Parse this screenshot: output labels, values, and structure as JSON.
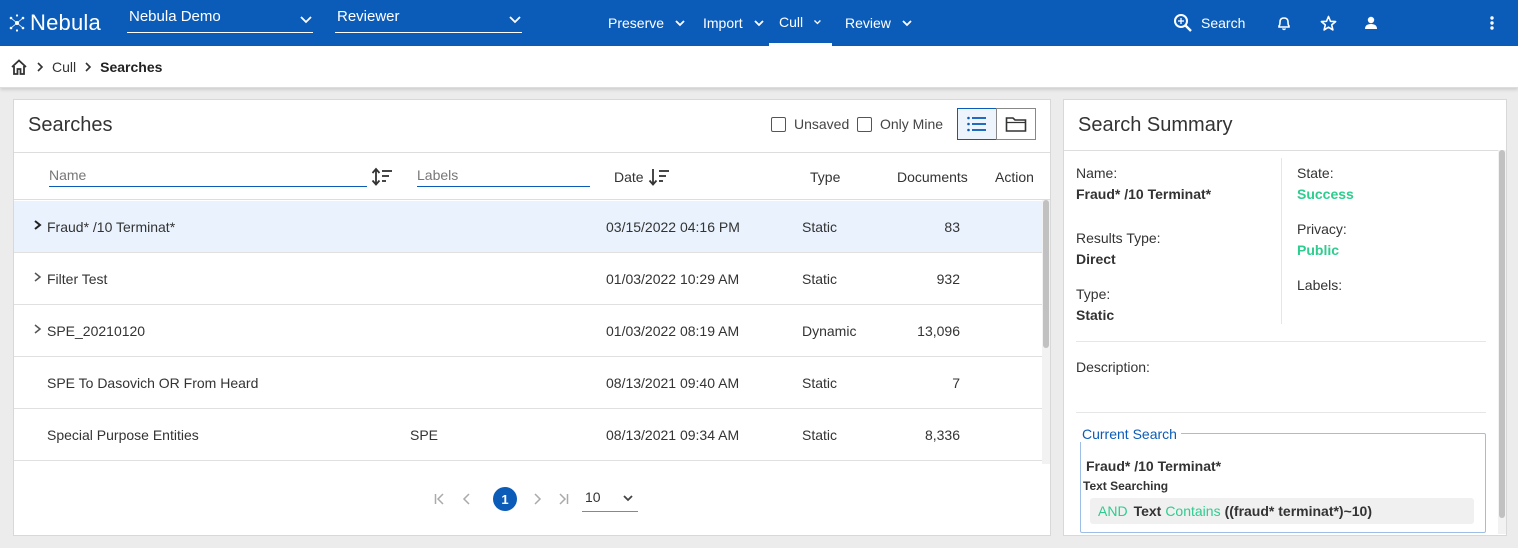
{
  "topbar": {
    "logo_text": "Nebula",
    "project_select": "Nebula Demo",
    "role_select": "Reviewer",
    "nav": [
      {
        "label": "Preserve",
        "active": false
      },
      {
        "label": "Import",
        "active": false
      },
      {
        "label": "Cull",
        "active": true
      },
      {
        "label": "Review",
        "active": false
      }
    ],
    "search_label": "Search"
  },
  "breadcrumb": {
    "items": [
      "Cull",
      "Searches"
    ]
  },
  "searches": {
    "title": "Searches",
    "unsaved_label": "Unsaved",
    "only_mine_label": "Only Mine",
    "columns": {
      "name_placeholder": "Name",
      "labels_placeholder": "Labels",
      "date": "Date",
      "type": "Type",
      "documents": "Documents",
      "action": "Action"
    },
    "rows": [
      {
        "name": "Fraud* /10 Terminat*",
        "labels": "",
        "date": "03/15/2022 04:16 PM",
        "type": "Static",
        "documents": "83",
        "expandable": true,
        "selected": true
      },
      {
        "name": "Filter Test",
        "labels": "",
        "date": "01/03/2022 10:29 AM",
        "type": "Static",
        "documents": "932",
        "expandable": true,
        "selected": false
      },
      {
        "name": "SPE_20210120",
        "labels": "",
        "date": "01/03/2022 08:19 AM",
        "type": "Dynamic",
        "documents": "13,096",
        "expandable": true,
        "selected": false
      },
      {
        "name": "SPE To Dasovich OR From Heard",
        "labels": "",
        "date": "08/13/2021 09:40 AM",
        "type": "Static",
        "documents": "7",
        "expandable": false,
        "selected": false
      },
      {
        "name": "Special Purpose Entities",
        "labels": "SPE",
        "date": "08/13/2021 09:34 AM",
        "type": "Static",
        "documents": "8,336",
        "expandable": false,
        "selected": false
      }
    ],
    "pagination": {
      "current_page": "1",
      "page_size": "10"
    }
  },
  "summary": {
    "title": "Search Summary",
    "name_label": "Name:",
    "name_value": "Fraud* /10 Terminat*",
    "results_type_label": "Results Type:",
    "results_type_value": "Direct",
    "type_label": "Type:",
    "type_value": "Static",
    "state_label": "State:",
    "state_value": "Success",
    "privacy_label": "Privacy:",
    "privacy_value": "Public",
    "labels_label": "Labels:",
    "description_label": "Description:",
    "current_search": {
      "legend": "Current Search",
      "name": "Fraud* /10 Terminat*",
      "subtitle": "Text Searching",
      "operator": "AND",
      "field": "Text",
      "condition": "Contains",
      "query": "((fraud* terminat*)~10)"
    }
  },
  "colors": {
    "brand": "#0b5cb8",
    "success": "#2ecc8f"
  }
}
